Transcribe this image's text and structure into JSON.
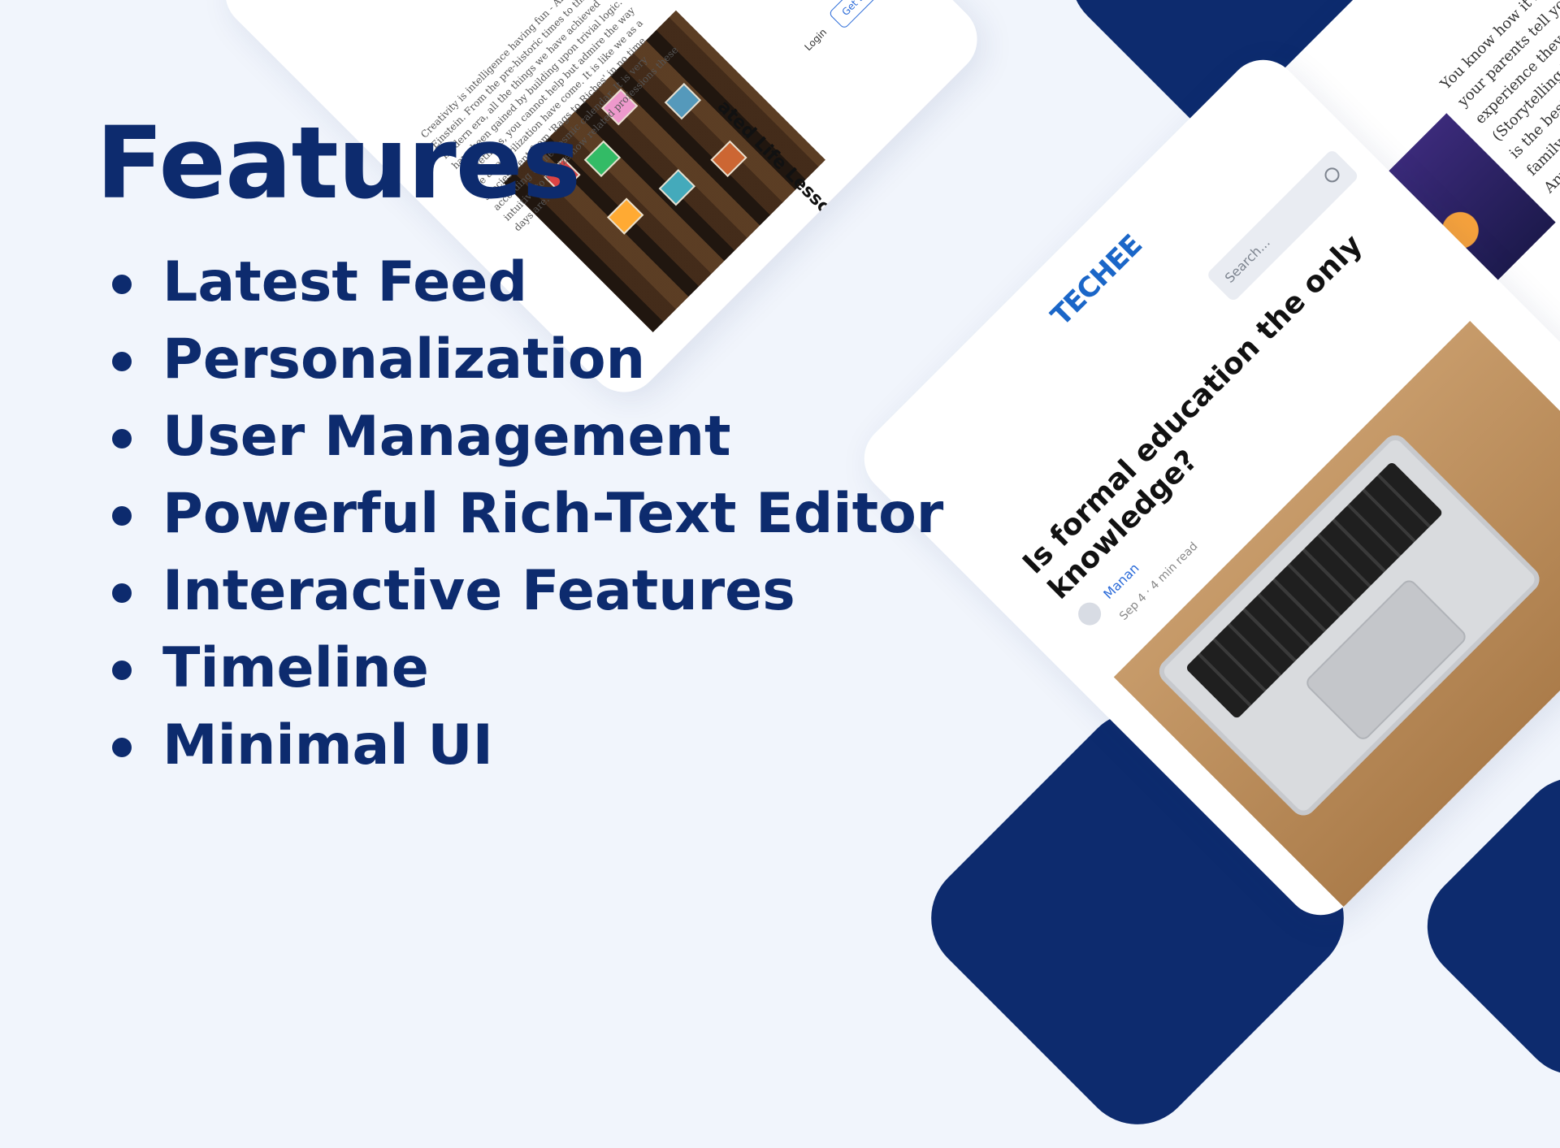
{
  "features": {
    "title": "Features",
    "items": [
      "Latest Feed",
      "Personalization",
      "User Management",
      "Powerful Rich-Text Editor",
      "Interactive Features",
      "Timeline",
      "Minimal UI"
    ]
  },
  "mockup_top": {
    "heading": "ated Life Lessons",
    "login_label": "Login",
    "get_started_label": "Get Started",
    "body": "Creativity is intelligence having fun - Albert Einstein. From the pre-historic times to this modern era, all the things we have achieved have been gained by building upon trivial logic. Sometimes, you cannot help but admire the way we as a civilization have come. It is like we as a species went from 'Rags to Riches' in no time according to the cosmic calendar. It is very intuitive to realize how related professions these days are."
  },
  "mockup_main": {
    "logo": "TECHEE",
    "search_placeholder": "Search...",
    "article_title": "Is formal education the only knowledge?",
    "author": "Manan",
    "meta": "Sep 4 · 4 min read"
  },
  "mockup_right": {
    "body": "You know how it is sometimes that your parents tell you about the experience they had in their life. (Storytelling has been... My father is the best storyteller in my whole family as all... astonishing tales. Anyways, he was telling me his career path... My father is an all-rounder who has been great at pretty much ev..."
  },
  "colors": {
    "navy": "#0d2b6e",
    "background": "#f1f5fc",
    "accent_blue": "#2a6ad8"
  }
}
